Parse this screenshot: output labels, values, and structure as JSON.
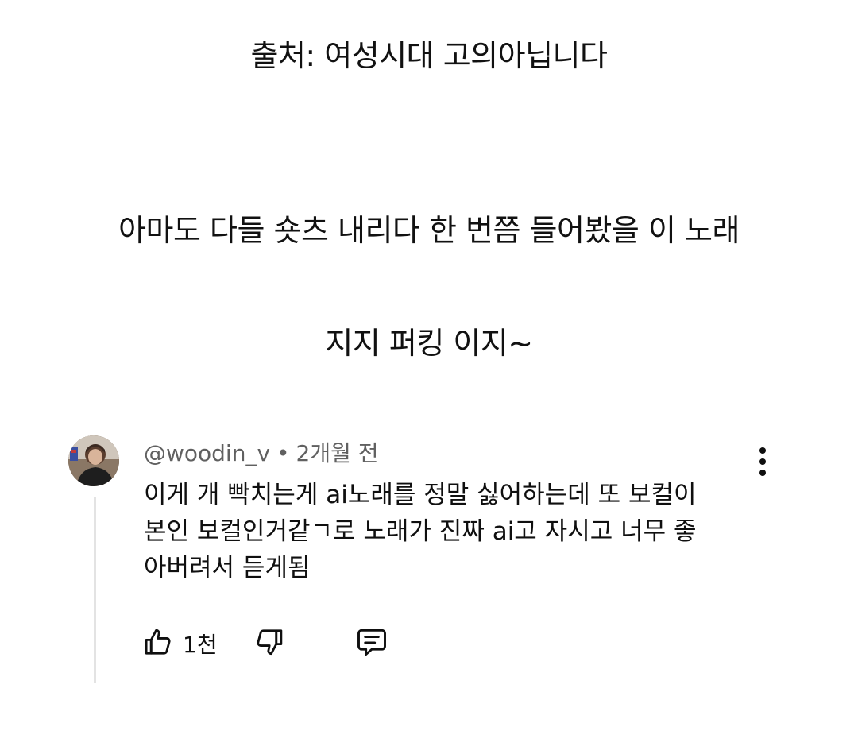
{
  "captions": {
    "source": "출처: 여성시대 고의아닙니다",
    "intro": "아마도 다들 숏츠 내리다 한 번쯤 들어봤을 이 노래",
    "song": "지지 퍼킹 이지~"
  },
  "comment": {
    "author": "@woodin_v",
    "separator": "•",
    "time": "2개월 전",
    "lines": [
      "이게 개 빡치는게 ai노래를 정말 싫어하는데 또 보컬이",
      "본인 보컬인거같ㄱ로 노래가 진짜 ai고 자시고 너무 좋",
      "아버려서 듣게됨"
    ],
    "like_count": "1천",
    "icons": {
      "like": "thumbs-up-icon",
      "dislike": "thumbs-down-icon",
      "reply": "reply-comment-icon",
      "menu": "more-vertical-icon"
    }
  }
}
